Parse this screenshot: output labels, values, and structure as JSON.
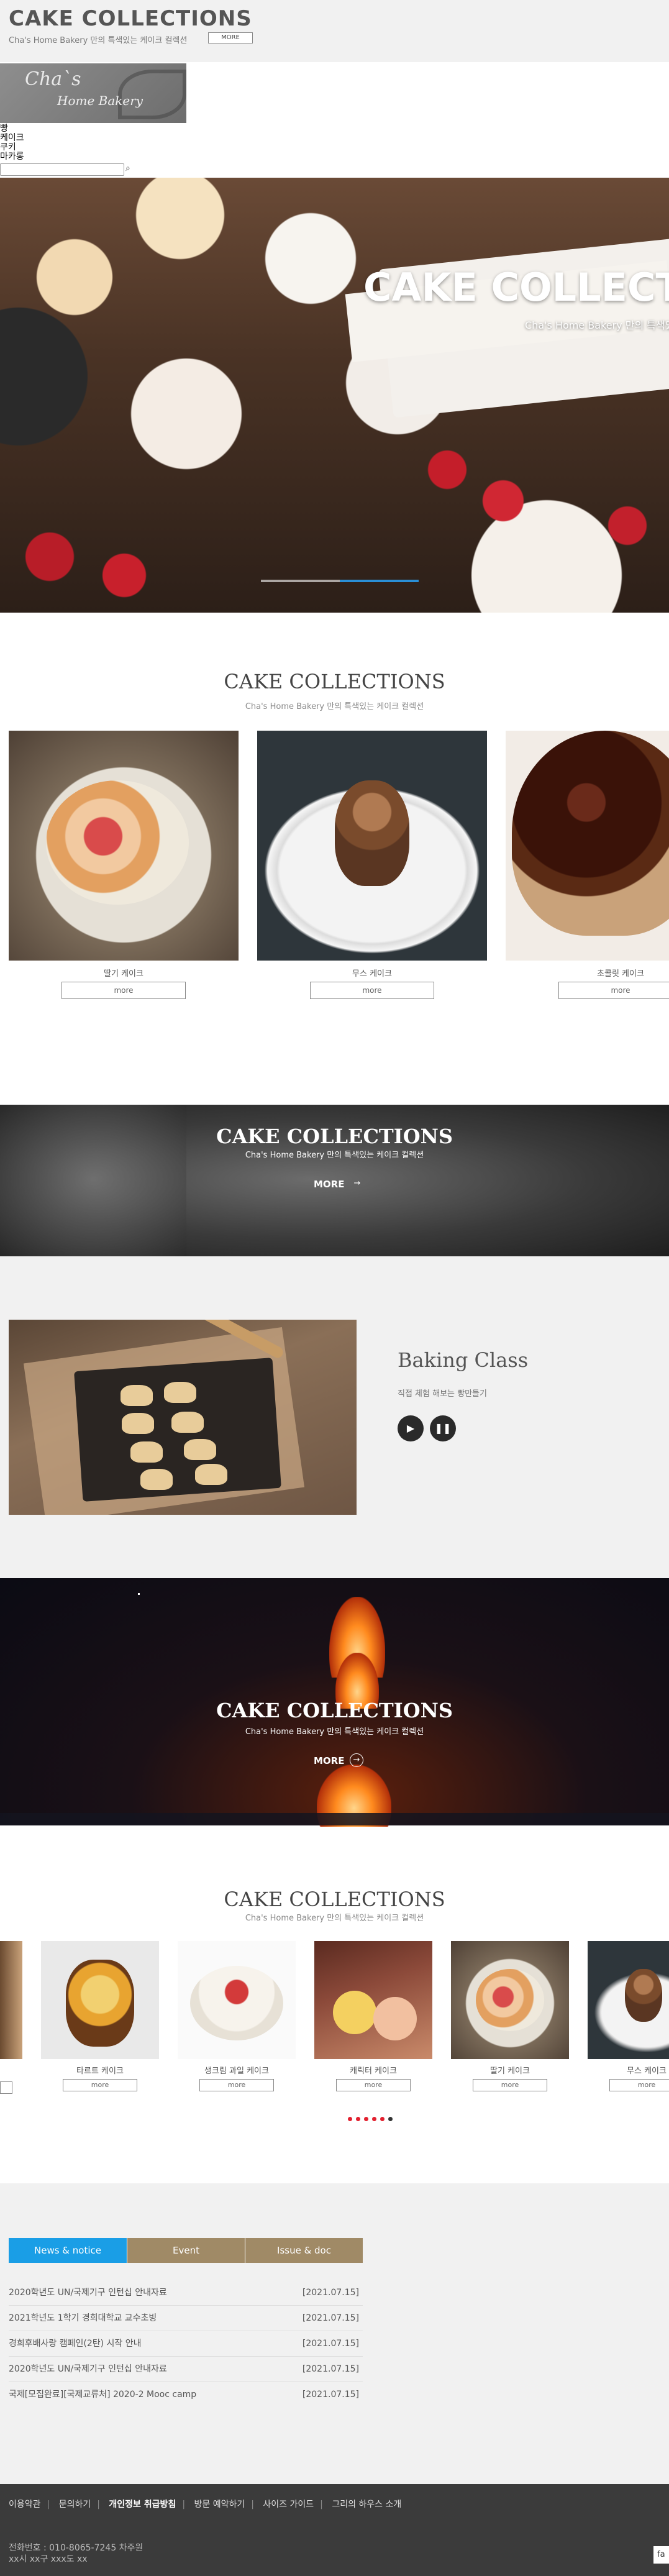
{
  "header": {
    "title": "CAKE COLLECTIONS",
    "subtitle": "Cha's Home Bakery 만의 특색있는 케이크 컬렉션",
    "more_label": "MORE"
  },
  "logo": {
    "line1": "Cha`s",
    "line2": "Home Bakery"
  },
  "nav": {
    "items": [
      "빵",
      "케이크",
      "쿠키",
      "마카롱"
    ]
  },
  "search": {
    "icon": "search-icon",
    "placeholder": ""
  },
  "hero": {
    "title": "CAKE COLLECTIONS",
    "subtitle": "Cha's Home Bakery 만의 특색있는 케이크 컬렉션",
    "slide_progress": 0.5
  },
  "collections": {
    "title": "CAKE COLLECTIONS",
    "subtitle": "Cha's Home Bakery 만의 특색있는 케이크 컬렉션",
    "cards": [
      {
        "name": "딸기 케이크",
        "more": "more"
      },
      {
        "name": "무스 케이크",
        "more": "more"
      },
      {
        "name": "초콜릿 케이크",
        "more": "more"
      }
    ]
  },
  "band1": {
    "title": "CAKE COLLECTIONS",
    "subtitle": "Cha's Home Bakery 만의 특색있는 케이크 컬렉션",
    "more_label": "MORE",
    "arrow": "arrow-right-icon"
  },
  "baking": {
    "title": "Baking Class",
    "subtitle": "직접 체험 해보는 빵만들기",
    "play_icon": "play-icon",
    "pause_icon": "pause-icon"
  },
  "band2": {
    "title": "CAKE COLLECTIONS",
    "subtitle": "Cha's Home Bakery 만의 특색있는 케이크 컬렉션",
    "more_label": "MORE",
    "arrow": "arrow-right-icon"
  },
  "slider": {
    "title": "CAKE COLLECTIONS",
    "subtitle": "Cha's Home Bakery 만의 특색있는 케이크 컬렉션",
    "items": [
      {
        "name": "",
        "more": ""
      },
      {
        "name": "타르트 케이크",
        "more": "more"
      },
      {
        "name": "생크림 과일 케이크",
        "more": "more"
      },
      {
        "name": "캐릭터 케이크",
        "more": "more"
      },
      {
        "name": "딸기 케이크",
        "more": "more"
      },
      {
        "name": "무스 케이크",
        "more": "more"
      }
    ],
    "dots": 6,
    "active_dot": 6
  },
  "notice": {
    "tabs": [
      "News & notice",
      "Event",
      "Issue & doc"
    ],
    "tab_colors": [
      "#1a9ee6",
      "#a08a66",
      "#a08a66"
    ],
    "rows": [
      {
        "title": "2020학년도 UN/국제기구 인턴십 안내자료",
        "date": "[2021.07.15]"
      },
      {
        "title": "2021학년도 1학기 경희대학교 교수초빙",
        "date": "[2021.07.15]"
      },
      {
        "title": "경희후배사랑 캠페인(2탄) 시작 안내",
        "date": "[2021.07.15]"
      },
      {
        "title": "2020학년도 UN/국제기구 인턴십 안내자료",
        "date": "[2021.07.15]"
      },
      {
        "title": "국제[모집완료][국제교류처] 2020-2 Mooc camp",
        "date": "[2021.07.15]"
      }
    ]
  },
  "footer": {
    "links": [
      "이용약관",
      "문의하기",
      "개인정보 취급방침",
      "방문 예약하기",
      "사이즈 가이드",
      "그리의 하우스 소개"
    ],
    "phone": "전화번호 : 010-8065-7245 차주원",
    "address": "xx시 xx구 xxx도 xx",
    "family": "fa"
  }
}
